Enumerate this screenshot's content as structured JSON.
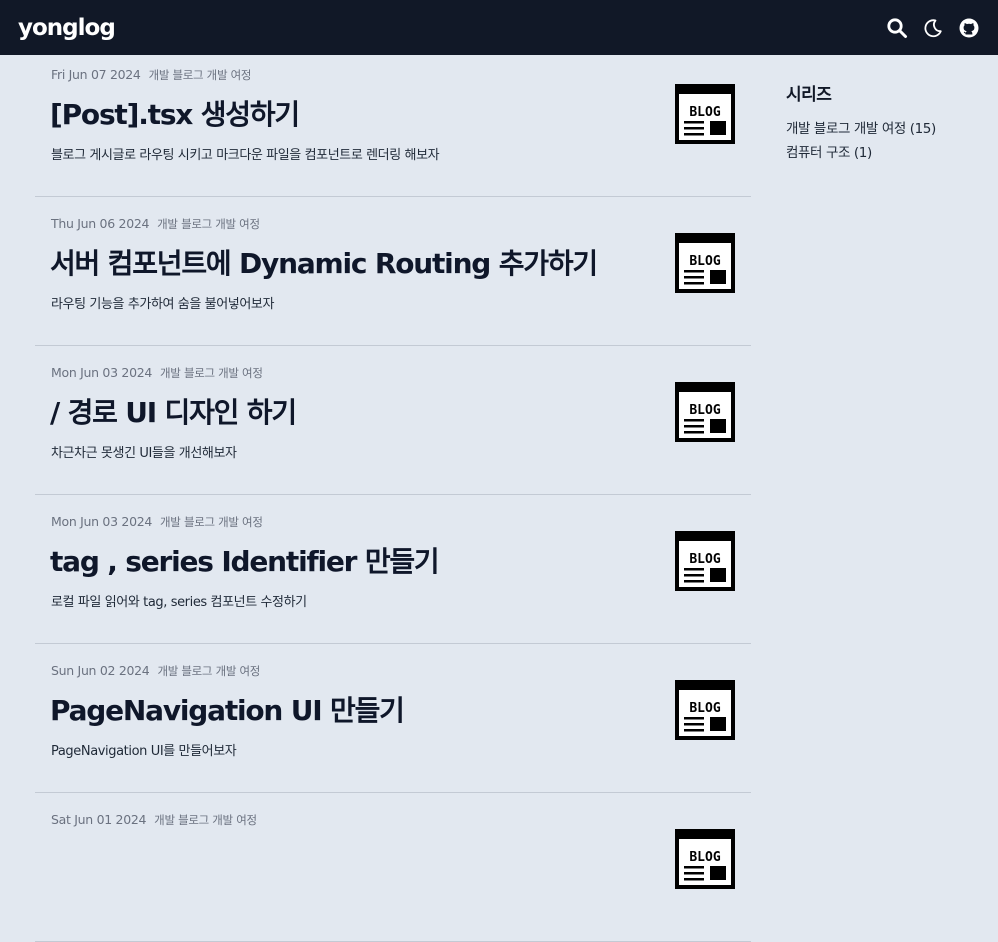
{
  "header": {
    "brand": "yonglog",
    "icons": [
      "search-icon",
      "moon-icon",
      "github-icon"
    ]
  },
  "thumbnail": {
    "label": "BLOG"
  },
  "posts": [
    {
      "date": "Fri Jun 07 2024",
      "series": "개발 블로그 개발 여정",
      "title": "[Post].tsx 생성하기",
      "description": "블로그 게시글로 라우팅 시키고 마크다운 파일을 컴포넌트로 렌더링 해보자"
    },
    {
      "date": "Thu Jun 06 2024",
      "series": "개발 블로그 개발 여정",
      "title": "서버 컴포넌트에 Dynamic Routing 추가하기",
      "description": "라우팅 기능을 추가하여 숨을 불어넣어보자"
    },
    {
      "date": "Mon Jun 03 2024",
      "series": "개발 블로그 개발 여정",
      "title": "/ 경로 UI 디자인 하기",
      "description": "차근차근 못생긴 UI들을 개선해보자"
    },
    {
      "date": "Mon Jun 03 2024",
      "series": "개발 블로그 개발 여정",
      "title": "tag , series Identifier 만들기",
      "description": "로컬 파일 읽어와 tag, series 컴포넌트 수정하기"
    },
    {
      "date": "Sun Jun 02 2024",
      "series": "개발 블로그 개발 여정",
      "title": "PageNavigation UI 만들기",
      "description": "PageNavigation UI를 만들어보자"
    },
    {
      "date": "Sat Jun 01 2024",
      "series": "개발 블로그 개발 여정",
      "title": "",
      "description": ""
    }
  ],
  "sidebar": {
    "heading": "시리즈",
    "items": [
      {
        "label": "개발 블로그 개발 여정 (15)"
      },
      {
        "label": "컴퓨터 구조 (1)"
      }
    ]
  },
  "colors": {
    "header_bg": "#111827",
    "page_bg": "#e2e8f0"
  }
}
